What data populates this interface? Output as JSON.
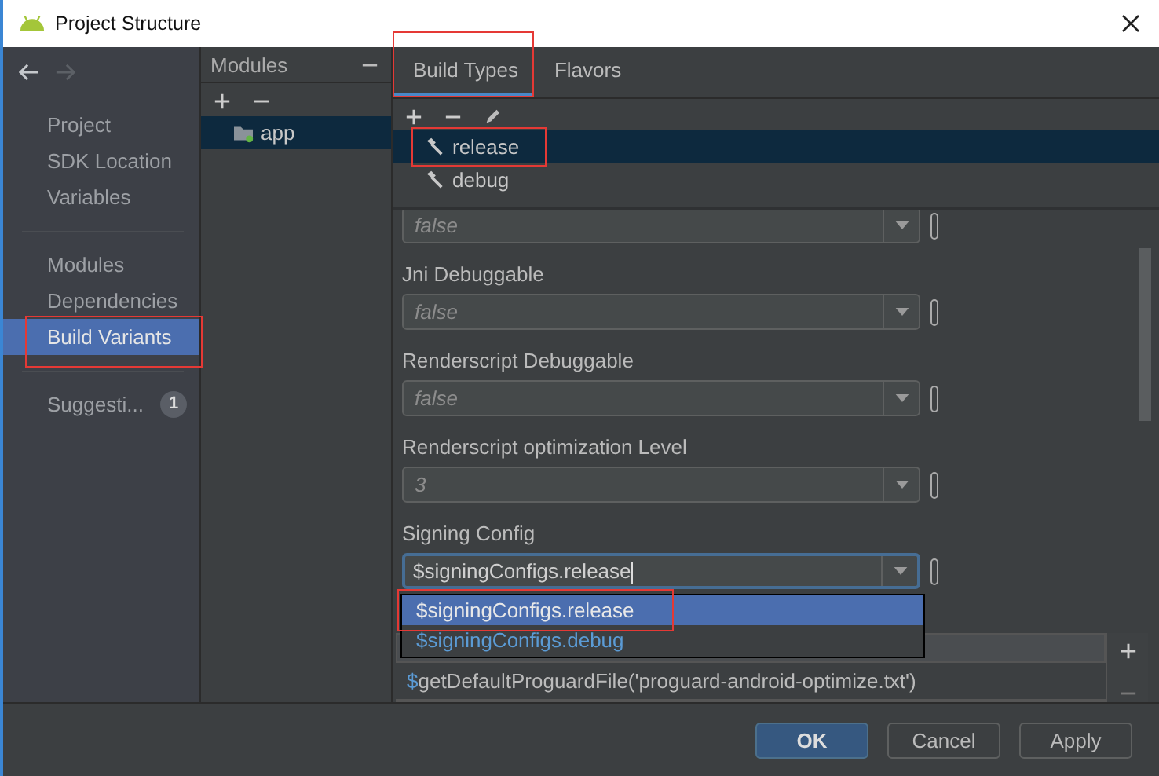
{
  "window": {
    "title": "Project Structure"
  },
  "sidebar": {
    "groups": [
      {
        "items": [
          {
            "label": "Project",
            "selected": false,
            "highlighted": false
          },
          {
            "label": "SDK Location",
            "selected": false,
            "highlighted": false
          },
          {
            "label": "Variables",
            "selected": false,
            "highlighted": false
          }
        ]
      },
      {
        "items": [
          {
            "label": "Modules",
            "selected": false,
            "highlighted": false
          },
          {
            "label": "Dependencies",
            "selected": false,
            "highlighted": false
          },
          {
            "label": "Build Variants",
            "selected": true,
            "highlighted": true
          }
        ]
      },
      {
        "items": [
          {
            "label": "Suggesti...",
            "selected": false,
            "highlighted": false,
            "badge": "1"
          }
        ]
      }
    ]
  },
  "modules": {
    "title": "Modules",
    "items": [
      {
        "label": "app",
        "selected": true
      }
    ]
  },
  "tabs": [
    {
      "label": "Build Types",
      "selected": true,
      "highlighted": true
    },
    {
      "label": "Flavors",
      "selected": false,
      "highlighted": false
    }
  ],
  "build_types": [
    {
      "label": "release",
      "selected": true,
      "highlighted": true
    },
    {
      "label": "debug",
      "selected": false,
      "highlighted": false
    }
  ],
  "fields": [
    {
      "value": "false"
    },
    {
      "label": "Jni Debuggable",
      "value": "false"
    },
    {
      "label": "Renderscript Debuggable",
      "value": "false"
    },
    {
      "label": "Renderscript optimization Level",
      "value": "3"
    },
    {
      "label": "Signing Config",
      "value": "$signingConfigs.release",
      "focused": true
    }
  ],
  "signing_dropdown": [
    {
      "label": "$signingConfigs.release",
      "selected": true,
      "highlighted": true
    },
    {
      "label": "$signingConfigs.debug",
      "selected": false,
      "highlighted": false
    }
  ],
  "proguard_files": [
    "$getDefaultProguardFile('proguard-android-optimize.txt')"
  ],
  "buttons": [
    {
      "label": "OK",
      "default": true
    },
    {
      "label": "Cancel",
      "default": false
    },
    {
      "label": "Apply",
      "default": false
    }
  ]
}
